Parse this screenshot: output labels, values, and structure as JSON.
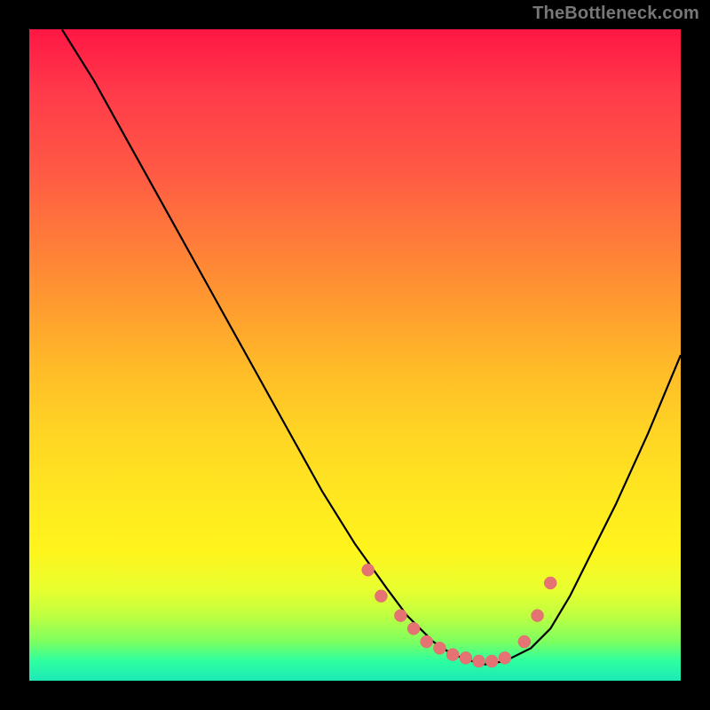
{
  "watermark": "TheBottleneck.com",
  "chart_data": {
    "type": "line",
    "title": "",
    "xlabel": "",
    "ylabel": "",
    "xlim": [
      0,
      100
    ],
    "ylim": [
      0,
      100
    ],
    "series": [
      {
        "name": "curve",
        "x": [
          5,
          10,
          15,
          20,
          25,
          30,
          35,
          40,
          45,
          50,
          55,
          58,
          60,
          62,
          65,
          68,
          70,
          73,
          77,
          80,
          83,
          86,
          90,
          95,
          100
        ],
        "y": [
          100,
          92,
          83,
          74,
          65,
          56,
          47,
          38,
          29,
          21,
          14,
          10,
          8,
          6,
          4,
          3,
          2.5,
          3,
          5,
          8,
          13,
          19,
          27,
          38,
          50
        ]
      }
    ],
    "markers": {
      "name": "highlight-dots",
      "x": [
        52,
        54,
        57,
        59,
        61,
        63,
        65,
        67,
        69,
        71,
        73,
        76,
        78,
        80
      ],
      "y": [
        17,
        13,
        10,
        8,
        6,
        5,
        4,
        3.5,
        3,
        3,
        3.5,
        6,
        10,
        15
      ]
    }
  }
}
